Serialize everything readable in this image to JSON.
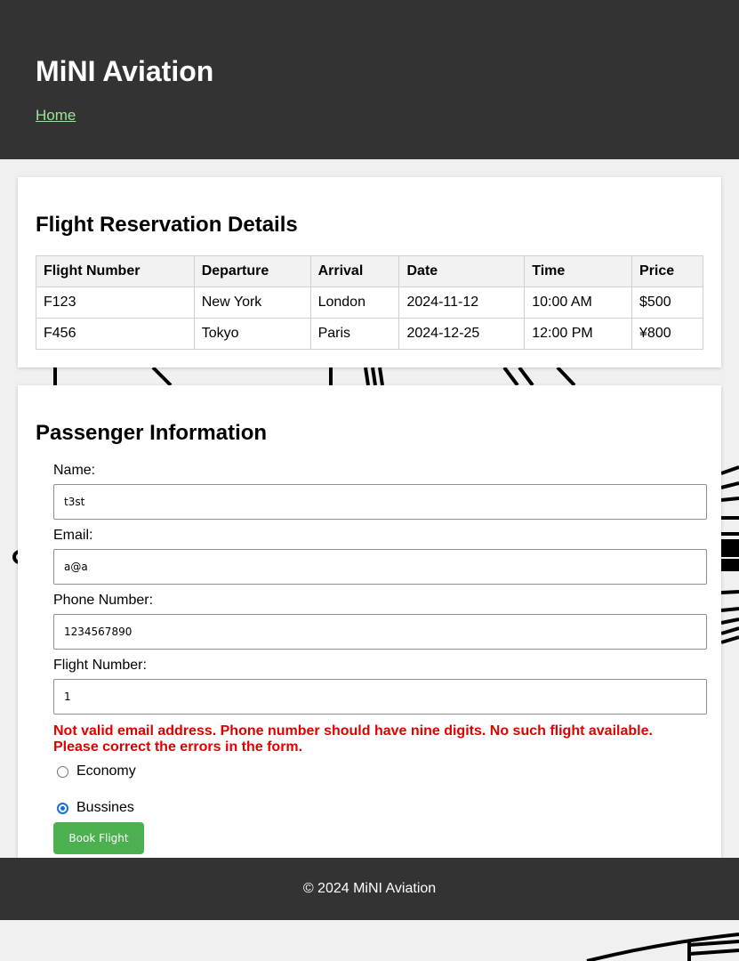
{
  "header": {
    "title": "MiNI Aviation",
    "nav_home": "Home"
  },
  "flights": {
    "heading": "Flight Reservation Details",
    "columns": [
      "Flight Number",
      "Departure",
      "Arrival",
      "Date",
      "Time",
      "Price"
    ],
    "rows": [
      [
        "F123",
        "New York",
        "London",
        "2024-11-12",
        "10:00 AM",
        "$500"
      ],
      [
        "F456",
        "Tokyo",
        "Paris",
        "2024-12-25",
        "12:00 PM",
        "¥800"
      ]
    ]
  },
  "passenger": {
    "heading": "Passenger Information",
    "name_label": "Name:",
    "name_value": "t3st",
    "email_label": "Email:",
    "email_value": "a@a",
    "phone_label": "Phone Number:",
    "phone_value": "1234567890",
    "flight_label": "Flight Number:",
    "flight_value": "1",
    "error_message": "Not valid email address. Phone number should have nine digits. No such flight available. Please correct the errors in the form.",
    "class_economy": "Economy",
    "class_business": "Bussines",
    "selected_class": "business",
    "book_button": "Book Flight"
  },
  "footer": {
    "text": "© 2024 MiNI Aviation"
  },
  "colors": {
    "header_bg": "#333333",
    "nav_link": "#98e698",
    "error": "#e00000",
    "button": "#4caf50",
    "radio_accent": "#1a6fd6"
  }
}
